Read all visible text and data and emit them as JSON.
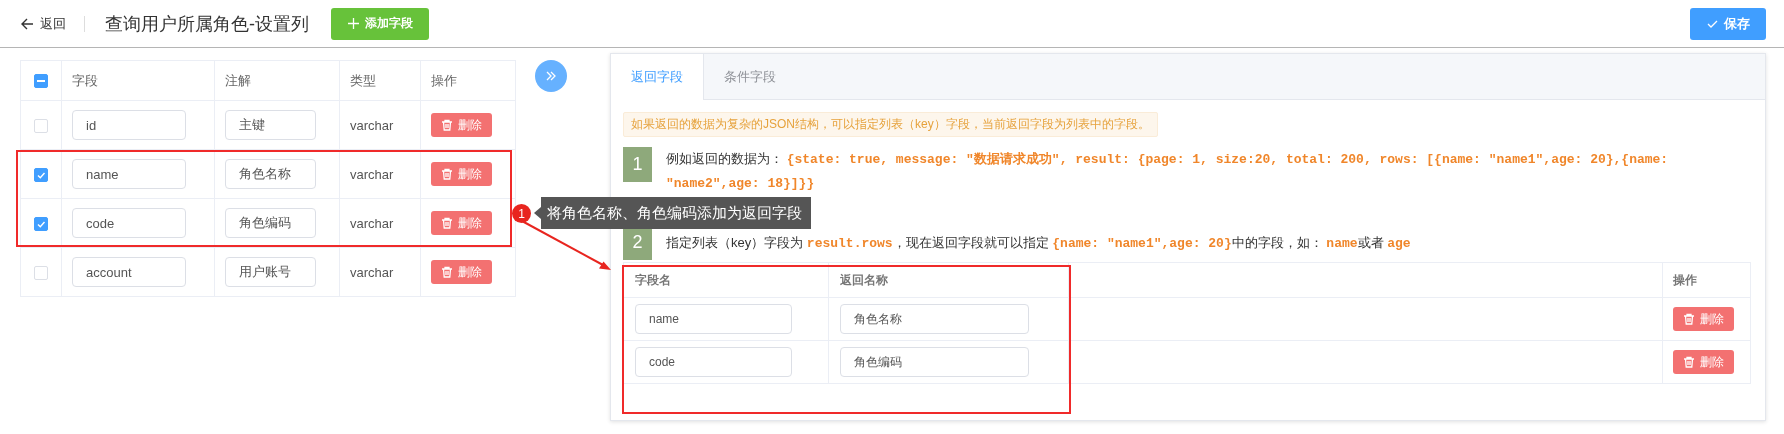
{
  "header": {
    "back": "返回",
    "title": "查询用户所属角色-设置列",
    "add_button": "添加字段",
    "save_button": "保存"
  },
  "field_table": {
    "select_all_indeterminate": true,
    "columns": [
      "字段",
      "注解",
      "类型",
      "操作"
    ],
    "rows": [
      {
        "field": "id",
        "comment": "主键",
        "type": "varchar",
        "checked": false,
        "action": "删除"
      },
      {
        "field": "name",
        "comment": "角色名称",
        "type": "varchar",
        "checked": true,
        "action": "删除"
      },
      {
        "field": "code",
        "comment": "角色编码",
        "type": "varchar",
        "checked": true,
        "action": "删除"
      },
      {
        "field": "account",
        "comment": "用户账号",
        "type": "varchar",
        "checked": false,
        "action": "删除"
      }
    ]
  },
  "panel": {
    "tabs": [
      {
        "label": "返回字段",
        "selected": true
      },
      {
        "label": "条件字段",
        "selected": false
      }
    ],
    "notice": "如果返回的数据为复杂的JSON结构，可以指定列表（key）字段，当前返回字段为列表中的字段。",
    "steps": [
      {
        "number": "1",
        "text": "例如返回的数据为： **{state: true, message: \"数据请求成功\", result: {page: 1, size:20, total: 200, rows: [{name: \"name1\",age: 20},{name: \"name2\",age: 18}]}}**"
      },
      {
        "number": "2",
        "text": "指定列表（key）字段为 **result.rows**，现在返回字段就可以指定 **{name: \"name1\",age: 20}**中的字段，如： **name**或者 **age**"
      }
    ],
    "table": {
      "columns": [
        "字段名",
        "返回名称",
        "操作"
      ],
      "rows": [
        {
          "field": "name",
          "name": "角色名称",
          "action": "删除"
        },
        {
          "field": "code",
          "name": "角色编码",
          "action": "删除"
        }
      ]
    }
  },
  "annotation": {
    "number": "1",
    "text": "将角色名称、角色编码添加为返回字段"
  }
}
